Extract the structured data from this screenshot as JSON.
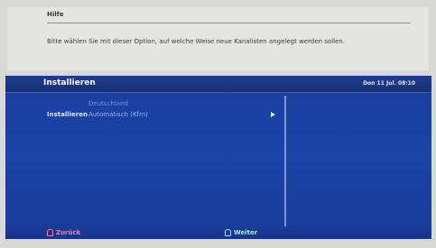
{
  "help": {
    "title": "Hilfe",
    "text": "Bitte wählen Sie mit dieser Option, auf welche Weise neue Kanalisten angelegt werden sollen."
  },
  "header": {
    "title": "Installieren",
    "date": "Don 11 Jul. 08:10"
  },
  "settings": {
    "country_value": "Deutschland",
    "install_label": "Installieren",
    "install_value": "Automatisch (Kfrn)"
  },
  "footer": {
    "back_label": "Zurück",
    "next_label": "Weiter"
  },
  "colors": {
    "panel_blue": "#1b44a8",
    "back_red": "#ff7f9a",
    "next_green": "#9cf0c8"
  }
}
